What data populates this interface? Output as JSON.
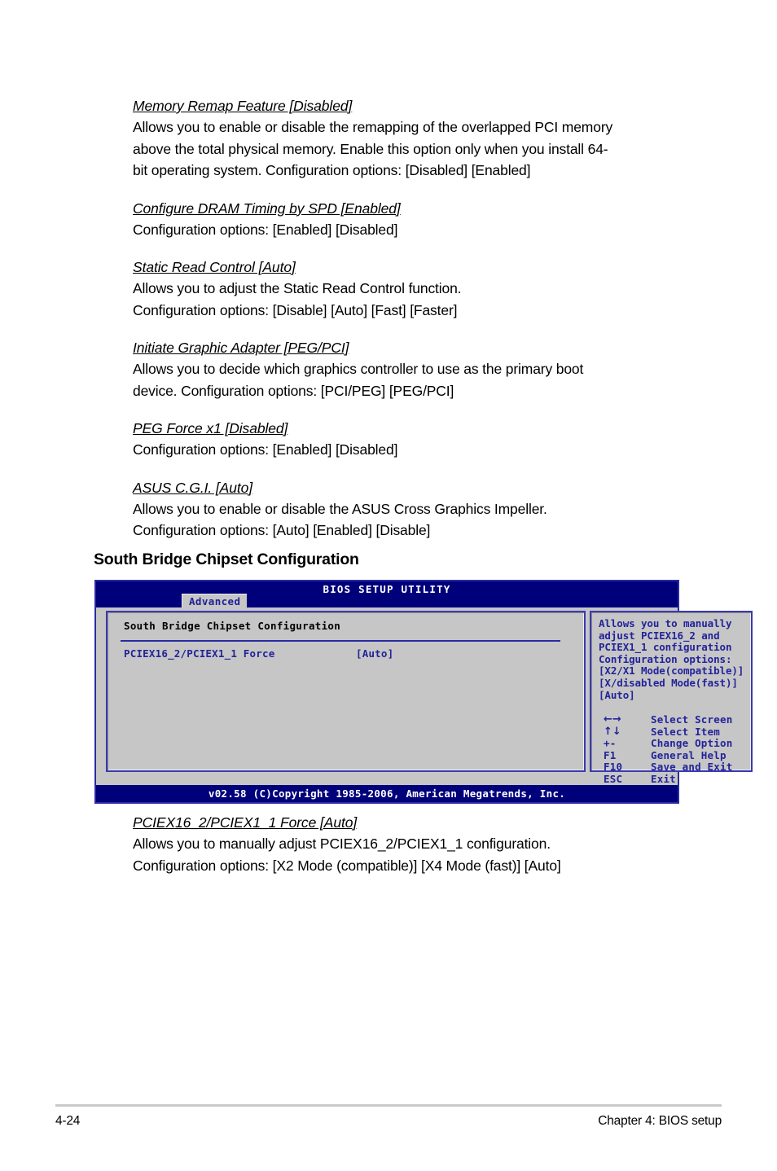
{
  "document": {
    "sections": [
      {
        "title": "Memory Remap Feature [Disabled]",
        "lines": [
          "Allows you to enable or disable the remapping of the overlapped PCI memory",
          "above the total physical memory. Enable this option only when you install 64-",
          "bit operating system. Configuration options: [Disabled] [Enabled]"
        ]
      },
      {
        "title": "Configure DRAM Timing by SPD [Enabled]",
        "lines": [
          "Configuration options: [Enabled] [Disabled]"
        ]
      },
      {
        "title": "Static Read Control [Auto]",
        "lines": [
          "Allows you to adjust the Static Read Control function.",
          "Configuration options: [Disable] [Auto] [Fast] [Faster]"
        ]
      },
      {
        "title": "Initiate Graphic Adapter [PEG/PCI]",
        "lines": [
          "Allows you to decide which graphics controller to use as the primary boot",
          "device. Configuration options: [PCI/PEG] [PEG/PCI]"
        ]
      },
      {
        "title": "PEG Force x1 [Disabled]",
        "lines": [
          "Configuration options: [Enabled] [Disabled]"
        ]
      },
      {
        "title": "ASUS C.G.I. [Auto]",
        "lines": [
          "Allows you to enable or disable the ASUS Cross Graphics Impeller.",
          "Configuration options: [Auto] [Enabled] [Disable]"
        ]
      }
    ],
    "heading": "South Bridge Chipset Configuration",
    "section_after": {
      "title": "PCIEX16_2/PCIEX1_1 Force [Auto]",
      "lines": [
        "Allows you to manually adjust PCIEX16_2/PCIEX1_1 configuration.",
        "Configuration options: [X2 Mode (compatible)] [X4 Mode (fast)] [Auto]"
      ]
    }
  },
  "bios": {
    "title": "BIOS SETUP UTILITY",
    "active_tab": "Advanced",
    "panel_title": "South Bridge Chipset Configuration",
    "item": {
      "label": "PCIEX16_2/PCIEX1_1 Force",
      "value": "[Auto]"
    },
    "help_lines": [
      "Allows you to manually",
      "adjust PCIEX16_2 and",
      "PCIEX1_1 configuration",
      "Configuration options:",
      "[X2/X1 Mode(compatible)]",
      "[X/disabled Mode(fast)]",
      "[Auto]"
    ],
    "legend": [
      {
        "key": "←→",
        "desc": "Select Screen",
        "arrows": true
      },
      {
        "key": "↑↓",
        "desc": "Select Item",
        "arrows": true
      },
      {
        "key": "+-",
        "desc": "Change Option",
        "arrows": false
      },
      {
        "key": "F1",
        "desc": "General Help",
        "arrows": false
      },
      {
        "key": "F10",
        "desc": "Save and Exit",
        "arrows": false
      },
      {
        "key": "ESC",
        "desc": "Exit",
        "arrows": false
      }
    ],
    "footer": "v02.58 (C)Copyright 1985-2006, American Megatrends, Inc.",
    "colors": {
      "header_blue": "#00007b",
      "border_blue": "#2a2aa5",
      "panel_gray": "#c6c6c6",
      "text_blue": "#23239b"
    }
  },
  "page_footer": {
    "page_number": "4-24",
    "chapter": "Chapter 4: BIOS setup"
  }
}
